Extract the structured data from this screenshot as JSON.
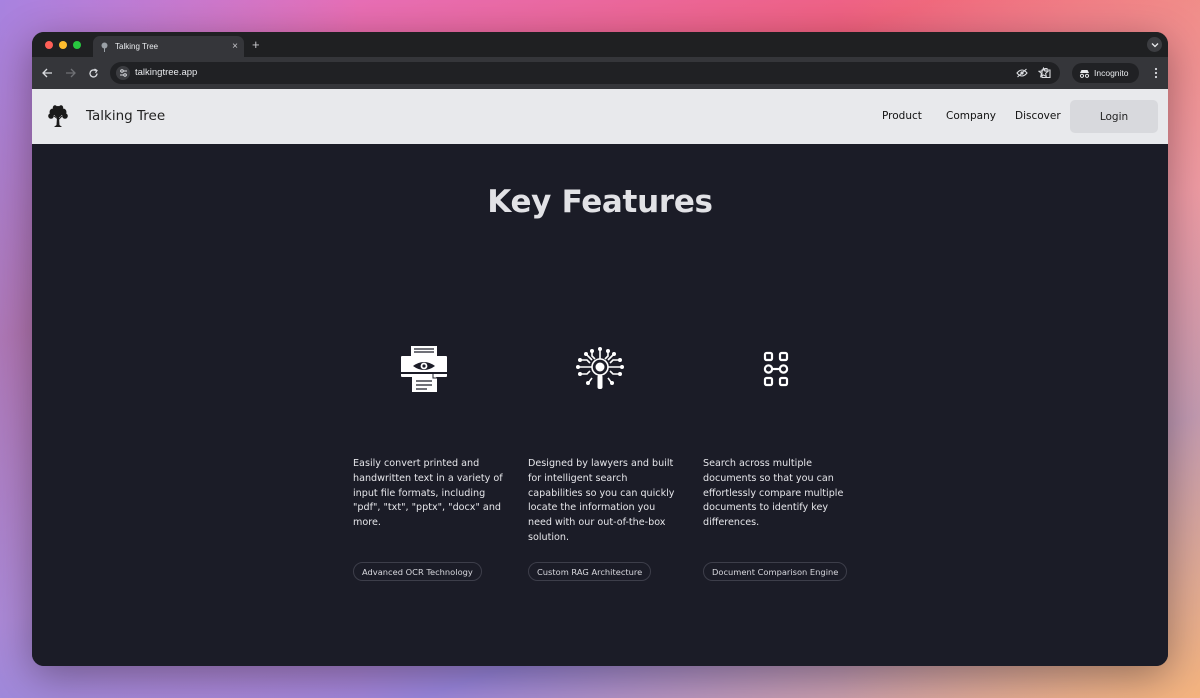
{
  "browser": {
    "tab_title": "Talking Tree",
    "new_tab_label": "+",
    "close_tab_label": "×",
    "url": "talkingtree.app",
    "incognito_label": "Incognito"
  },
  "site": {
    "brand": "Talking Tree",
    "nav": [
      "Product",
      "Company",
      "Discover"
    ],
    "login_label": "Login"
  },
  "main": {
    "heading": "Key Features",
    "features": [
      {
        "icon": "ocr-scanner-icon",
        "description": "Easily convert printed and handwritten text in a variety of input file formats, including \"pdf\", \"txt\", \"pptx\", \"docx\" and more.",
        "badge": "Advanced OCR Technology"
      },
      {
        "icon": "ai-search-icon",
        "description": "Designed by lawyers and built for intelligent search capabilities so you can quickly locate the information you need with our out-of-the-box solution.",
        "badge": "Custom RAG Architecture"
      },
      {
        "icon": "document-compare-icon",
        "description": "Search across multiple documents so that you can effortlessly compare multiple documents to identify key differences.",
        "badge": "Document Comparison Engine"
      }
    ]
  },
  "colors": {
    "page_bg": "#1b1c27",
    "header_bg": "#e8e9ec",
    "login_bg": "#d8d9dd",
    "text_light": "#e6e6ea"
  }
}
